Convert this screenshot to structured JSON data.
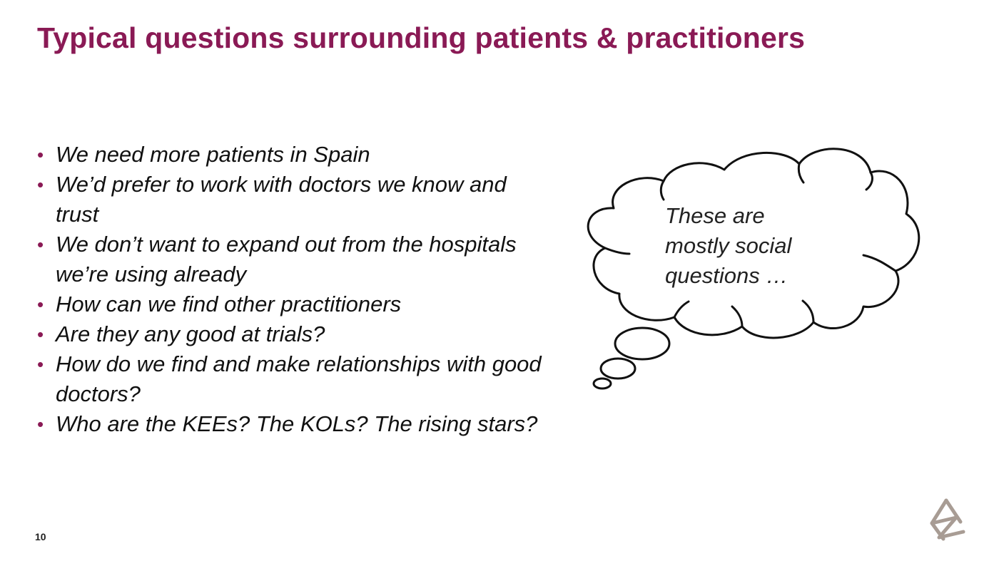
{
  "slide": {
    "title": "Typical questions surrounding patients & practitioners",
    "page_number": "10"
  },
  "bullets": [
    "We need more patients in Spain",
    "We’d prefer to work with doctors we know and trust",
    "We don’t want to expand out from the hospitals we’re using already",
    "How can we find other practitioners",
    "Are they any good at trials?",
    "How do we find and make relationships with good doctors?",
    "Who are the KEEs? The KOLs? The rising stars?"
  ],
  "thought_bubble": {
    "lines": [
      "These are",
      "mostly social",
      "questions …"
    ]
  },
  "colors": {
    "accent": "#8a1a55",
    "text": "#111111",
    "logo": "#a89c94"
  },
  "icons": {
    "logo": "company-logo-icon",
    "bubble": "thought-cloud-icon"
  }
}
